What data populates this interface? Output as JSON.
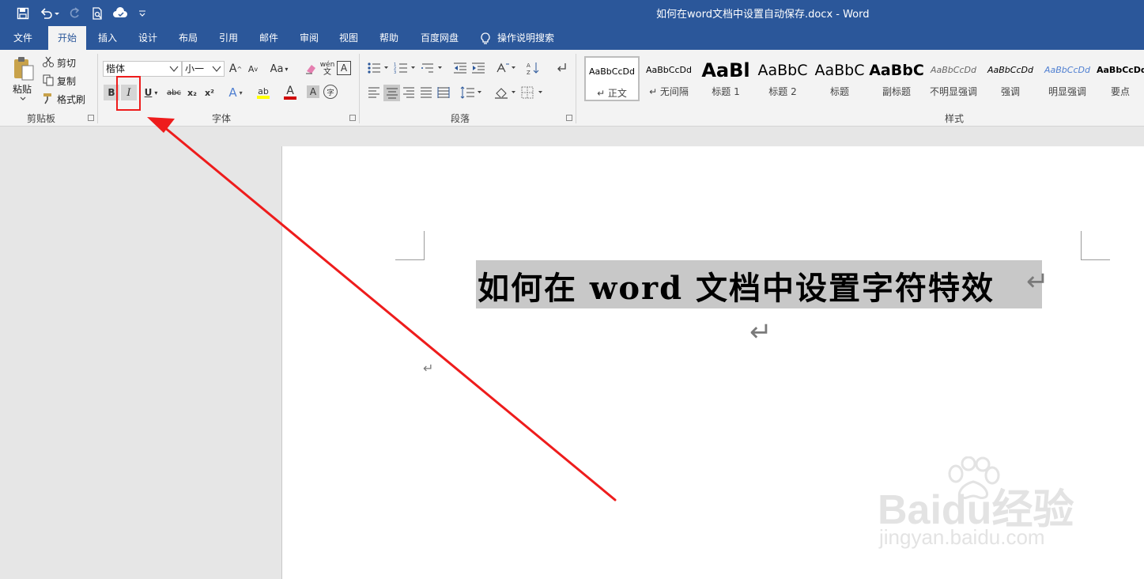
{
  "window": {
    "title": "如何在word文档中设置自动保存.docx  -  Word"
  },
  "tabs": [
    {
      "label": "文件"
    },
    {
      "label": "开始"
    },
    {
      "label": "插入"
    },
    {
      "label": "设计"
    },
    {
      "label": "布局"
    },
    {
      "label": "引用"
    },
    {
      "label": "邮件"
    },
    {
      "label": "审阅"
    },
    {
      "label": "视图"
    },
    {
      "label": "帮助"
    },
    {
      "label": "百度网盘"
    },
    {
      "label": "操作说明搜索"
    }
  ],
  "active_tab": "开始",
  "clipboard": {
    "paste_label": "粘贴",
    "cut_label": "剪切",
    "copy_label": "复制",
    "format_painter_label": "格式刷",
    "group_label": "剪贴板"
  },
  "font": {
    "font_name": "楷体",
    "font_size": "小一",
    "grow_label": "A",
    "shrink_label": "A",
    "case_label": "Aa",
    "phonetic_label": "wén",
    "border_char_label": "A",
    "bold_label": "B",
    "italic_label": "I",
    "underline_label": "U",
    "strike_label": "abc",
    "subscript_label": "x₂",
    "superscript_label": "x²",
    "effects_label": "A",
    "highlight_label": "ab",
    "font_color_label": "A",
    "shading_label": "A",
    "enclose_label": "字",
    "group_label": "字体"
  },
  "paragraph": {
    "group_label": "段落"
  },
  "styles": {
    "group_label": "样式",
    "items": [
      {
        "sample": "AaBbCcDd",
        "name": "↵ 正文"
      },
      {
        "sample": "AaBbCcDd",
        "name": "↵ 无间隔"
      },
      {
        "sample": "AaBl",
        "name": "标题 1"
      },
      {
        "sample": "AaBbC",
        "name": "标题 2"
      },
      {
        "sample": "AaBbC",
        "name": "标题"
      },
      {
        "sample": "AaBbC",
        "name": "副标题"
      },
      {
        "sample": "AaBbCcDd",
        "name": "不明显强调"
      },
      {
        "sample": "AaBbCcDd",
        "name": "强调"
      },
      {
        "sample": "AaBbCcDd",
        "name": "明显强调"
      },
      {
        "sample": "AaBbCcDd",
        "name": "要点"
      }
    ]
  },
  "document": {
    "heading": "如何在 word 文档中设置字符特效",
    "paragraph_mark": "↵"
  },
  "watermark": {
    "brand_text": "Baidu经验",
    "url_text": "jingyan.baidu.com"
  },
  "colors": {
    "title_bar": "#2b579a",
    "ribbon_bg": "#f3f3f3",
    "annotation_red": "#ee1c1c",
    "highlight_yellow": "#ffff00",
    "font_color_red": "#d00000"
  }
}
